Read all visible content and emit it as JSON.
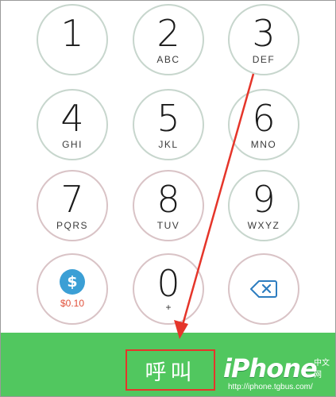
{
  "keys": [
    {
      "digit": "1",
      "letters": ""
    },
    {
      "digit": "2",
      "letters": "ABC"
    },
    {
      "digit": "3",
      "letters": "DEF"
    },
    {
      "digit": "4",
      "letters": "GHI"
    },
    {
      "digit": "5",
      "letters": "JKL"
    },
    {
      "digit": "6",
      "letters": "MNO"
    },
    {
      "digit": "7",
      "letters": "PQRS"
    },
    {
      "digit": "8",
      "letters": "TUV"
    },
    {
      "digit": "9",
      "letters": "WXYZ"
    },
    {
      "digit": "0",
      "letters": "+"
    }
  ],
  "credit": {
    "icon": "dollar-coin-icon",
    "symbol": "$",
    "balance": "$0.10"
  },
  "delete": {
    "icon": "backspace-icon"
  },
  "call": {
    "label": "呼叫"
  },
  "watermark": {
    "brand": "iPhone",
    "brand_cn": "中文网",
    "url": "http://iphone.tgbus.com/"
  },
  "colors": {
    "call_bar": "#51c75f",
    "annotation_red": "#e5352a",
    "key_ring": "#c7d6cd",
    "key_ring_pink": "#d9c3c6",
    "balance_text": "#e0503a",
    "coin": "#3b9fd5"
  }
}
